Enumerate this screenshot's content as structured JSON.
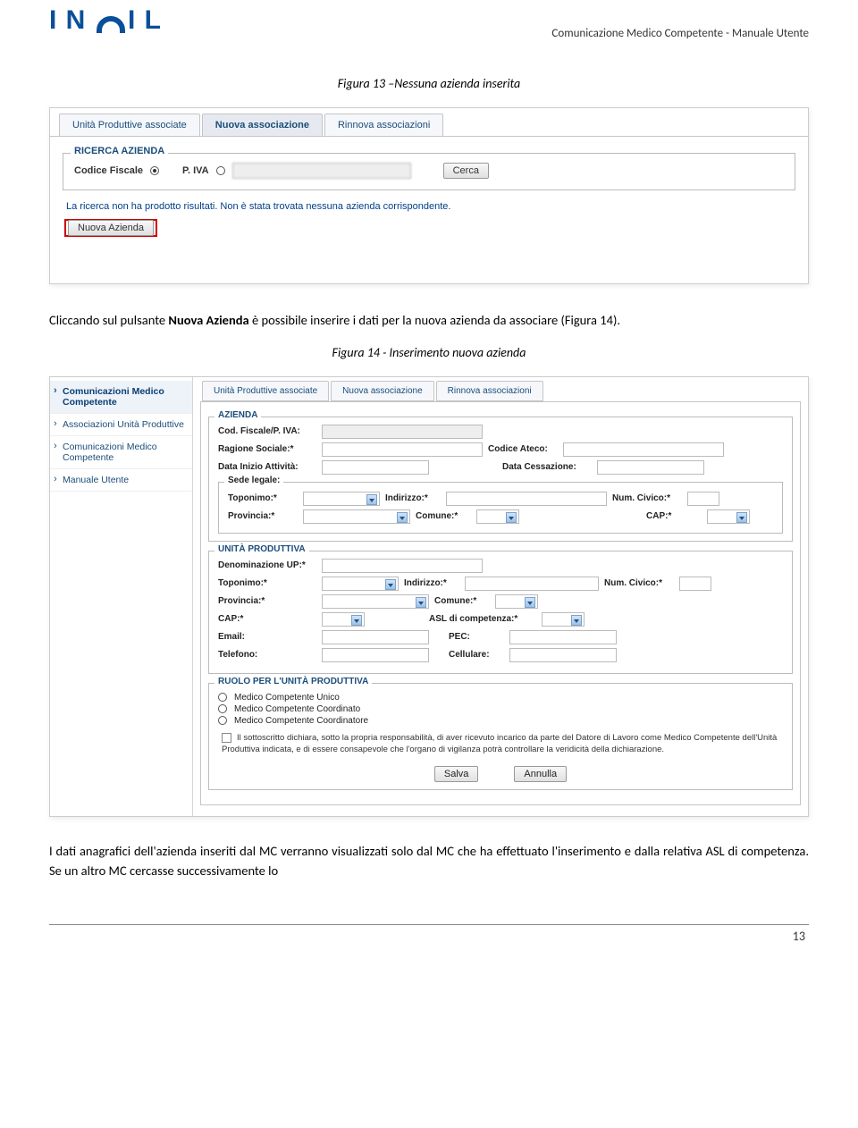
{
  "header": {
    "logo_text": "INAIL",
    "title": "Comunicazione Medico Competente - Manuale Utente"
  },
  "caption1": "Figura 13 –Nessuna azienda inserita",
  "screenshot1": {
    "tabs": {
      "t1": "Unità Produttive associate",
      "t2": "Nuova associazione",
      "t3": "Rinnova associazioni"
    },
    "fieldset_legend": "RICERCA AZIENDA",
    "label_cf": "Codice Fiscale",
    "label_piva": "P. IVA",
    "btn_search": "Cerca",
    "no_results": "La ricerca non ha prodotto risultati. Non è stata trovata nessuna azienda corrispondente.",
    "btn_new": "Nuova Azienda"
  },
  "para1_a": "Cliccando sul pulsante ",
  "para1_b": "Nuova Azienda",
  "para1_c": " è possibile inserire i dati per la nuova azienda da associare (Figura 14).",
  "caption2": "Figura 14 - Inserimento nuova azienda",
  "screenshot2": {
    "side": {
      "s1": "Comunicazioni Medico Competente",
      "s2": "Associazioni Unità Produttive",
      "s3": "Comunicazioni Medico Competente",
      "s4": "Manuale Utente"
    },
    "tabs": {
      "t1": "Unità Produttive associate",
      "t2": "Nuova associazione",
      "t3": "Rinnova associazioni"
    },
    "azienda_legend": "AZIENDA",
    "az": {
      "cf": "Cod. Fiscale/P. IVA:",
      "rs": "Ragione Sociale:*",
      "ateco": "Codice Ateco:",
      "din": "Data Inizio Attività:",
      "dcess": "Data Cessazione:"
    },
    "sede_legend": "Sede legale:",
    "sede": {
      "top": "Toponimo:*",
      "ind": "Indirizzo:*",
      "nc": "Num. Civico:*",
      "prov": "Provincia:*",
      "com": "Comune:*",
      "cap": "CAP:*"
    },
    "up_legend": "UNITÀ PRODUTTIVA",
    "up": {
      "den": "Denominazione UP:*",
      "top": "Toponimo:*",
      "ind": "Indirizzo:*",
      "nc": "Num. Civico:*",
      "prov": "Provincia:*",
      "com": "Comune:*",
      "cap": "CAP:*",
      "asl": "ASL di competenza:*",
      "email": "Email:",
      "pec": "PEC:",
      "tel": "Telefono:",
      "cell": "Cellulare:"
    },
    "ruolo_legend": "RUOLO PER L'UNITÀ PRODUTTIVA",
    "ruolo": {
      "r1": "Medico Competente Unico",
      "r2": "Medico Competente Coordinato",
      "r3": "Medico Competente Coordinatore"
    },
    "decl": "Il sottoscritto dichiara, sotto la propria responsabilità, di aver ricevuto incarico da parte del Datore di Lavoro come Medico Competente dell'Unità Produttiva indicata, e di essere consapevole che l'organo di vigilanza potrà controllare la veridicità della dichiarazione.",
    "btn_save": "Salva",
    "btn_cancel": "Annulla"
  },
  "para2": "I dati anagrafici dell'azienda inseriti dal MC verranno visualizzati solo dal MC che ha effettuato l'inserimento e dalla relativa ASL di competenza. Se un altro MC cercasse successivamente lo",
  "page_number": "13"
}
